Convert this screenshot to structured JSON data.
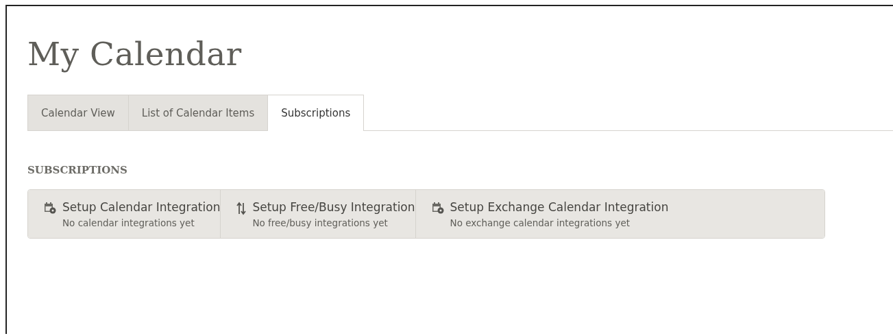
{
  "page": {
    "title": "My Calendar"
  },
  "tabs": [
    {
      "label": "Calendar View",
      "selected": false
    },
    {
      "label": "List of Calendar Items",
      "selected": false
    },
    {
      "label": "Subscriptions",
      "selected": true
    }
  ],
  "section": {
    "heading": "SUBSCRIPTIONS"
  },
  "integrations": [
    {
      "kind": "calendar",
      "title": "Setup Calendar Integration",
      "status": "No calendar integrations yet"
    },
    {
      "kind": "sync",
      "title": "Setup Free/Busy Integration",
      "status": "No free/busy integrations yet"
    },
    {
      "kind": "calendar",
      "title": "Setup Exchange Calendar Integration",
      "status": "No exchange calendar integrations yet"
    }
  ]
}
